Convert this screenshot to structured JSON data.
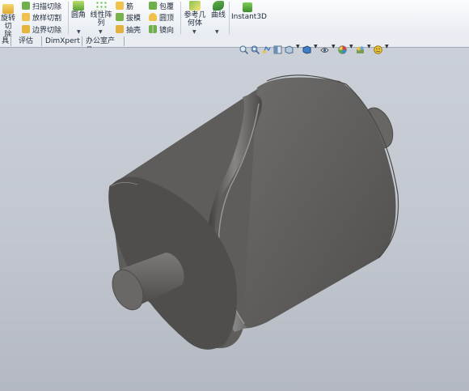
{
  "ribbon": {
    "revolve_cut": "旋转切\n除",
    "sweep_cut": "扫描切除",
    "loft_cut": "放样切割",
    "boundary_cut": "边界切除",
    "fillet": "圆角",
    "linear_pattern": "线性阵\n列",
    "rib": "筋",
    "draft": "拔模",
    "shell": "抽壳",
    "wrap": "包覆",
    "dome": "圆顶",
    "mirror": "镜向",
    "reference_geometry": "参考几\n何体",
    "curves": "曲线",
    "instant3d": "Instant3D"
  },
  "tabs": [
    "具",
    "评估",
    "DimXpert",
    "办公室产品"
  ],
  "colors": {
    "ribbon_bg": "#eef1f5",
    "viewport_bg": "#c6cbd3",
    "model_body": "#5f5e5c",
    "model_face": "#6e6d6b"
  },
  "hud_icons": [
    "zoom-to-fit-icon",
    "zoom-area-icon",
    "previous-view-icon",
    "section-view-icon",
    "view-orientation-icon",
    "display-style-icon",
    "hide-show-items-icon",
    "edit-appearance-icon",
    "apply-scene-icon",
    "view-settings-icon"
  ]
}
